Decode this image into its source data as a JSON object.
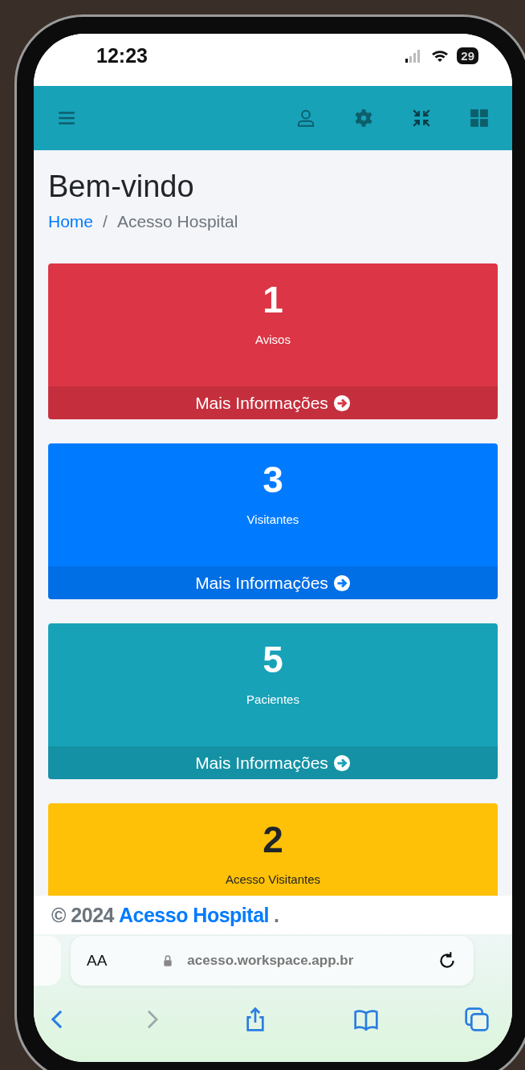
{
  "status_bar": {
    "time": "12:23",
    "battery": "29"
  },
  "page": {
    "title": "Bem-vindo",
    "breadcrumb": [
      {
        "label": "Home",
        "kind": "link"
      },
      {
        "label": "/",
        "kind": "separator"
      },
      {
        "label": "Acesso Hospital",
        "kind": "current"
      }
    ]
  },
  "cards": [
    {
      "count": "1",
      "label": "Avisos",
      "link": "Mais Informações",
      "color": "#dc3545"
    },
    {
      "count": "3",
      "label": "Visitantes",
      "link": "Mais Informações",
      "color": "#007bff"
    },
    {
      "count": "5",
      "label": "Pacientes",
      "link": "Mais Informações",
      "color": "#17a2b8"
    },
    {
      "count": "2",
      "label": "Acesso Visitantes",
      "color": "#ffc107"
    }
  ],
  "footer": {
    "copyright": "© 2024",
    "brand": "Acesso Hospital",
    "suffix": "."
  },
  "browser": {
    "text_size": "AA",
    "url": "acesso.workspace.app.br"
  }
}
